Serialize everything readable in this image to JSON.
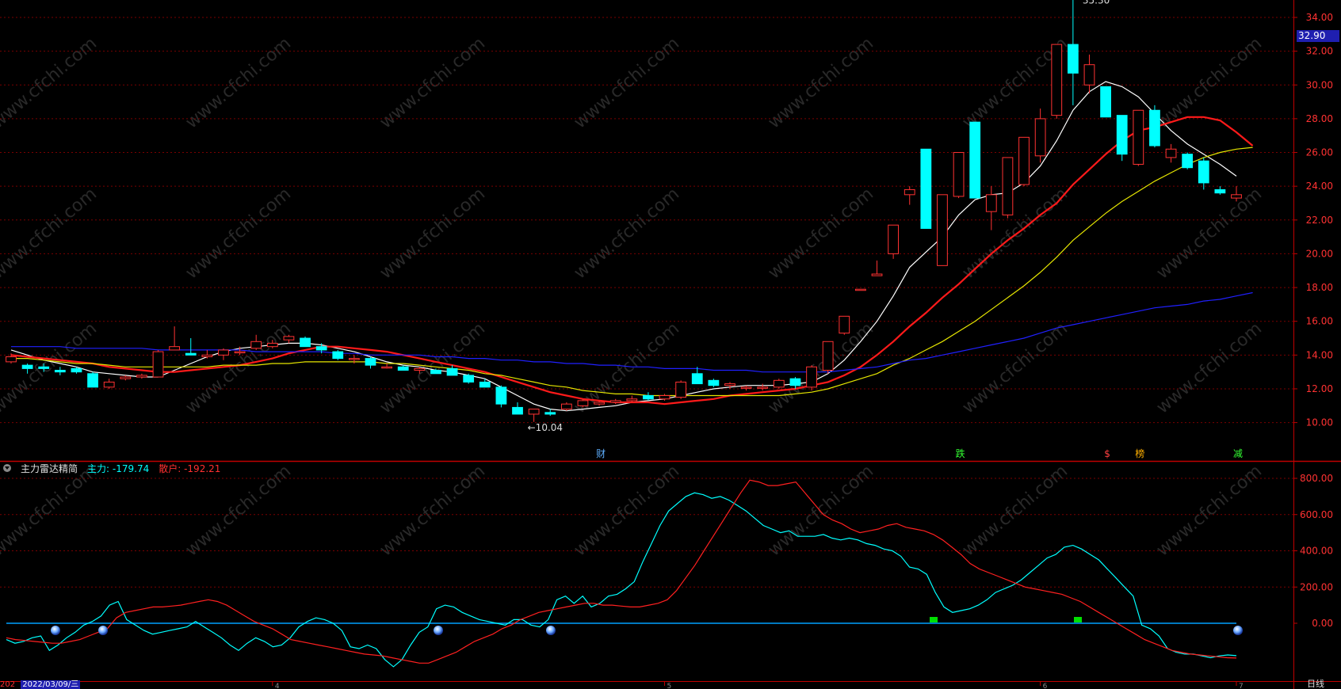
{
  "price_axis": {
    "labels": [
      "34.00",
      "32.00",
      "30.00",
      "28.00",
      "26.00",
      "24.00",
      "22.00",
      "20.00",
      "18.00",
      "16.00",
      "14.00",
      "12.00",
      "10.00"
    ],
    "current_price": "32.90",
    "ylim": [
      9.0,
      35.6
    ]
  },
  "indicator_axis": {
    "labels": [
      "800.00",
      "600.00",
      "400.00",
      "200.00",
      "0.00"
    ],
    "ylim": [
      -310,
      840
    ]
  },
  "indicator_header": {
    "name": "主力雷达精简",
    "main_label": "主力:",
    "main_value": "-179.74",
    "retail_label": "散户:",
    "retail_value": "-192.21"
  },
  "annotations": {
    "high": "35.30",
    "low": "10.04",
    "event_cai": "财",
    "event_die": "跌",
    "event_dollar": "$",
    "event_bang": "榜",
    "event_jian": "减"
  },
  "time_axis": {
    "year_label": "202",
    "date_label": "2022/03/09/三",
    "months": [
      "4",
      "5",
      "6",
      "7"
    ],
    "period": "日线"
  },
  "colors": {
    "up": "#ff3232",
    "down": "#00ffff",
    "ma5": "#ffffff",
    "ma10": "#ff1a1a",
    "ma20": "#e6e600",
    "ma60": "#2020ff",
    "grid": "#7a0000",
    "zero_line": "#00a0ff",
    "border": "#c00000"
  },
  "watermark": "www.cfchi.com",
  "chart_data": {
    "type": "candlestick",
    "candles": [
      [
        13.6,
        14.1,
        13.5,
        13.9
      ],
      [
        13.4,
        13.5,
        12.9,
        13.2
      ],
      [
        13.3,
        13.5,
        13.0,
        13.2
      ],
      [
        13.1,
        13.3,
        12.8,
        13.0
      ],
      [
        13.2,
        13.3,
        12.9,
        13.0
      ],
      [
        12.9,
        13.0,
        12.1,
        12.1
      ],
      [
        12.1,
        12.6,
        12.0,
        12.4
      ],
      [
        12.6,
        12.8,
        12.5,
        12.7
      ],
      [
        12.7,
        12.9,
        12.6,
        12.8
      ],
      [
        12.7,
        14.3,
        12.7,
        14.2
      ],
      [
        14.3,
        15.7,
        14.3,
        14.5
      ],
      [
        14.1,
        15.0,
        14.0,
        14.0
      ],
      [
        13.9,
        14.3,
        13.8,
        14.0
      ],
      [
        14.0,
        14.4,
        13.7,
        14.3
      ],
      [
        14.2,
        14.5,
        14.0,
        14.2
      ],
      [
        14.4,
        15.2,
        14.3,
        14.8
      ],
      [
        14.5,
        14.9,
        14.4,
        14.7
      ],
      [
        14.9,
        15.2,
        14.7,
        15.1
      ],
      [
        15.0,
        15.1,
        14.5,
        14.5
      ],
      [
        14.5,
        14.7,
        14.1,
        14.3
      ],
      [
        14.2,
        14.3,
        13.7,
        13.8
      ],
      [
        13.8,
        14.0,
        13.5,
        13.8
      ],
      [
        13.8,
        13.9,
        13.2,
        13.4
      ],
      [
        13.3,
        13.5,
        13.2,
        13.3
      ],
      [
        13.3,
        13.4,
        13.1,
        13.1
      ],
      [
        13.1,
        13.3,
        12.9,
        13.2
      ],
      [
        13.1,
        13.2,
        12.9,
        12.9
      ],
      [
        13.2,
        13.4,
        12.8,
        12.8
      ],
      [
        12.8,
        12.9,
        12.3,
        12.4
      ],
      [
        12.4,
        12.6,
        12.2,
        12.1
      ],
      [
        12.1,
        12.2,
        10.9,
        11.1
      ],
      [
        10.9,
        11.2,
        10.5,
        10.5
      ],
      [
        10.5,
        10.8,
        10.04,
        10.8
      ],
      [
        10.6,
        10.8,
        10.4,
        10.5
      ],
      [
        10.8,
        11.2,
        10.7,
        11.1
      ],
      [
        11.0,
        11.4,
        10.9,
        11.3
      ],
      [
        11.1,
        11.3,
        11.0,
        11.2
      ],
      [
        11.2,
        11.4,
        11.1,
        11.3
      ],
      [
        11.3,
        11.6,
        11.2,
        11.4
      ],
      [
        11.6,
        11.8,
        11.3,
        11.4
      ],
      [
        11.4,
        11.7,
        11.3,
        11.6
      ],
      [
        11.5,
        12.5,
        11.4,
        12.4
      ],
      [
        12.9,
        13.3,
        12.7,
        12.3
      ],
      [
        12.5,
        12.6,
        12.1,
        12.2
      ],
      [
        12.2,
        12.4,
        12.0,
        12.3
      ],
      [
        12.1,
        12.2,
        11.9,
        12.1
      ],
      [
        12.1,
        12.3,
        11.9,
        12.1
      ],
      [
        12.1,
        12.6,
        12.0,
        12.5
      ],
      [
        12.6,
        12.7,
        12.0,
        12.2
      ],
      [
        12.1,
        13.4,
        11.9,
        13.3
      ],
      [
        13.1,
        14.6,
        12.9,
        14.8
      ],
      [
        15.3,
        16.3,
        15.2,
        16.3
      ],
      [
        17.9,
        17.9,
        17.9,
        17.9
      ],
      [
        18.7,
        19.6,
        18.7,
        18.8
      ],
      [
        20.0,
        21.7,
        19.7,
        21.7
      ],
      [
        23.5,
        24.0,
        22.9,
        23.8
      ],
      [
        26.2,
        26.2,
        21.5,
        21.5
      ],
      [
        19.3,
        23.5,
        19.3,
        23.5
      ],
      [
        23.4,
        26.0,
        23.3,
        26.0
      ],
      [
        27.8,
        27.8,
        23.3,
        23.3
      ],
      [
        22.5,
        24.0,
        21.4,
        23.5
      ],
      [
        22.3,
        25.7,
        22.1,
        25.7
      ],
      [
        24.1,
        26.9,
        24.0,
        26.9
      ],
      [
        25.8,
        28.6,
        25.4,
        28.0
      ],
      [
        28.2,
        32.4,
        28.0,
        32.4
      ],
      [
        32.4,
        35.3,
        28.8,
        30.7
      ],
      [
        30.0,
        31.8,
        29.5,
        31.2
      ],
      [
        29.9,
        29.9,
        28.1,
        28.1
      ],
      [
        28.2,
        28.2,
        25.5,
        25.9
      ],
      [
        25.3,
        28.5,
        25.2,
        28.5
      ],
      [
        28.5,
        28.8,
        26.3,
        26.4
      ],
      [
        25.7,
        26.5,
        25.4,
        26.2
      ],
      [
        25.9,
        26.0,
        25.0,
        25.1
      ],
      [
        25.5,
        25.7,
        23.8,
        24.2
      ],
      [
        23.8,
        24.0,
        23.5,
        23.6
      ],
      [
        23.3,
        24.0,
        23.1,
        23.5
      ]
    ],
    "series": [
      {
        "name": "MA5",
        "values": [
          14.3,
          14.0,
          13.7,
          13.5,
          13.3,
          13.0,
          12.9,
          12.8,
          12.7,
          12.7,
          13.1,
          13.5,
          13.9,
          14.2,
          14.4,
          14.5,
          14.6,
          14.7,
          14.7,
          14.6,
          14.4,
          14.2,
          13.9,
          13.6,
          13.4,
          13.3,
          13.1,
          13.0,
          12.8,
          12.6,
          12.1,
          11.6,
          11.1,
          10.8,
          10.7,
          10.8,
          10.9,
          11.0,
          11.2,
          11.3,
          11.4,
          11.6,
          11.8,
          12.0,
          12.1,
          12.2,
          12.2,
          12.2,
          12.3,
          12.4,
          12.9,
          13.7,
          14.8,
          16.0,
          17.5,
          19.2,
          20.1,
          21.0,
          22.3,
          23.2,
          23.5,
          23.6,
          24.2,
          25.2,
          26.7,
          28.5,
          29.6,
          30.2,
          29.9,
          29.3,
          28.3,
          27.3,
          26.5,
          25.9,
          25.3,
          24.6
        ]
      },
      {
        "name": "MA10",
        "values": [
          14.0,
          13.9,
          13.8,
          13.7,
          13.6,
          13.5,
          13.3,
          13.2,
          13.1,
          13.0,
          13.0,
          13.1,
          13.2,
          13.3,
          13.4,
          13.6,
          13.8,
          14.1,
          14.3,
          14.5,
          14.5,
          14.4,
          14.3,
          14.2,
          14.0,
          13.8,
          13.6,
          13.4,
          13.2,
          13.0,
          12.7,
          12.4,
          12.1,
          11.8,
          11.6,
          11.4,
          11.3,
          11.2,
          11.2,
          11.2,
          11.1,
          11.2,
          11.3,
          11.4,
          11.6,
          11.7,
          11.8,
          11.9,
          12.0,
          12.2,
          12.4,
          12.8,
          13.3,
          14.0,
          14.8,
          15.7,
          16.5,
          17.4,
          18.2,
          19.1,
          20.0,
          20.8,
          21.5,
          22.3,
          23.0,
          24.1,
          25.0,
          25.9,
          26.7,
          27.3,
          27.5,
          27.8,
          28.1,
          28.1,
          27.9,
          27.2,
          26.4
        ]
      },
      {
        "name": "MA20",
        "values": [
          13.8,
          13.8,
          13.7,
          13.6,
          13.5,
          13.5,
          13.4,
          13.3,
          13.3,
          13.3,
          13.3,
          13.3,
          13.3,
          13.4,
          13.4,
          13.4,
          13.5,
          13.5,
          13.6,
          13.6,
          13.6,
          13.6,
          13.6,
          13.5,
          13.5,
          13.4,
          13.3,
          13.2,
          13.1,
          12.9,
          12.8,
          12.6,
          12.4,
          12.2,
          12.1,
          11.9,
          11.8,
          11.7,
          11.7,
          11.6,
          11.6,
          11.6,
          11.6,
          11.6,
          11.6,
          11.6,
          11.6,
          11.6,
          11.7,
          11.8,
          12.0,
          12.3,
          12.6,
          12.9,
          13.4,
          13.8,
          14.3,
          14.8,
          15.4,
          16.0,
          16.7,
          17.4,
          18.1,
          18.9,
          19.8,
          20.8,
          21.6,
          22.4,
          23.1,
          23.7,
          24.3,
          24.8,
          25.3,
          25.7,
          26.0,
          26.2,
          26.3
        ]
      },
      {
        "name": "MA60",
        "values": [
          14.5,
          14.5,
          14.5,
          14.5,
          14.4,
          14.4,
          14.4,
          14.4,
          14.4,
          14.3,
          14.3,
          14.3,
          14.3,
          14.3,
          14.3,
          14.2,
          14.2,
          14.2,
          14.2,
          14.2,
          14.1,
          14.1,
          14.0,
          14.0,
          14.0,
          14.0,
          13.9,
          13.9,
          13.8,
          13.8,
          13.7,
          13.7,
          13.6,
          13.6,
          13.5,
          13.5,
          13.4,
          13.4,
          13.3,
          13.3,
          13.2,
          13.2,
          13.2,
          13.1,
          13.1,
          13.1,
          13.0,
          13.0,
          13.0,
          13.0,
          13.0,
          13.1,
          13.2,
          13.3,
          13.5,
          13.7,
          13.8,
          14.0,
          14.2,
          14.4,
          14.6,
          14.8,
          15.0,
          15.3,
          15.6,
          15.8,
          16.0,
          16.2,
          16.4,
          16.6,
          16.8,
          16.9,
          17.0,
          17.2,
          17.3,
          17.5,
          17.7
        ]
      }
    ],
    "indicator": {
      "name": "主力雷达精简",
      "series": [
        {
          "name": "主力",
          "values": [
            -90,
            -110,
            -100,
            -80,
            -70,
            -150,
            -120,
            -80,
            -50,
            -10,
            10,
            40,
            100,
            120,
            20,
            -10,
            -40,
            -60,
            -50,
            -40,
            -30,
            -20,
            10,
            -20,
            -50,
            -80,
            -120,
            -150,
            -110,
            -80,
            -100,
            -130,
            -120,
            -80,
            -20,
            10,
            30,
            20,
            0,
            -40,
            -130,
            -140,
            -120,
            -140,
            -200,
            -240,
            -200,
            -120,
            -50,
            -20,
            80,
            100,
            90,
            60,
            40,
            20,
            10,
            0,
            -10,
            20,
            20,
            -10,
            -20,
            20,
            130,
            150,
            110,
            150,
            90,
            110,
            150,
            160,
            190,
            230,
            340,
            440,
            540,
            620,
            660,
            700,
            720,
            710,
            690,
            700,
            680,
            650,
            620,
            580,
            540,
            520,
            500,
            510,
            480,
            480,
            480,
            490,
            470,
            460,
            470,
            460,
            440,
            430,
            410,
            400,
            370,
            310,
            300,
            270,
            170,
            90,
            60,
            70,
            80,
            100,
            130,
            170,
            190,
            210,
            240,
            280,
            320,
            360,
            380,
            420,
            430,
            410,
            380,
            350,
            300,
            250,
            200,
            150,
            -10,
            -30,
            -70,
            -140,
            -160,
            -170,
            -170,
            -180,
            -190,
            -180,
            -175,
            -179
          ]
        },
        {
          "name": "散户",
          "values": [
            -80,
            -90,
            -95,
            -100,
            -105,
            -110,
            -110,
            -100,
            -90,
            -70,
            -50,
            -30,
            30,
            60,
            70,
            80,
            90,
            90,
            95,
            100,
            110,
            120,
            130,
            120,
            100,
            70,
            40,
            10,
            -10,
            -30,
            -60,
            -90,
            -100,
            -110,
            -120,
            -130,
            -140,
            -150,
            -160,
            -170,
            -175,
            -180,
            -190,
            -200,
            -210,
            -220,
            -220,
            -200,
            -180,
            -160,
            -130,
            -100,
            -80,
            -60,
            -30,
            -10,
            20,
            40,
            60,
            70,
            80,
            90,
            100,
            110,
            110,
            100,
            100,
            95,
            90,
            90,
            100,
            110,
            130,
            180,
            250,
            320,
            400,
            480,
            560,
            640,
            720,
            790,
            780,
            760,
            760,
            770,
            780,
            720,
            660,
            600,
            570,
            550,
            520,
            500,
            510,
            520,
            540,
            550,
            530,
            520,
            510,
            490,
            460,
            420,
            380,
            330,
            300,
            280,
            260,
            240,
            220,
            200,
            190,
            180,
            170,
            160,
            140,
            120,
            90,
            60,
            30,
            0,
            -30,
            -60,
            -90,
            -110,
            -130,
            -150,
            -160,
            -170,
            -175,
            -180,
            -185,
            -190,
            -192
          ]
        }
      ]
    }
  }
}
